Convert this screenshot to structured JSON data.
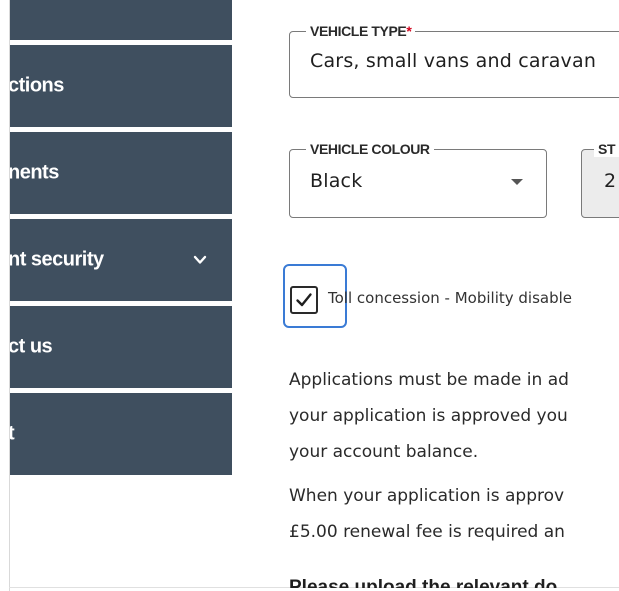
{
  "sidebar": {
    "items": [
      {
        "label": ""
      },
      {
        "label": "ctions"
      },
      {
        "label": "nents"
      },
      {
        "label": "nt security",
        "icon": "chevron-down-icon"
      },
      {
        "label": "ct us"
      },
      {
        "label": "t"
      }
    ]
  },
  "form": {
    "vehicle_type": {
      "label": "VEHICLE TYPE",
      "required_marker": "*",
      "value": "Cars, small vans and caravan"
    },
    "vehicle_colour": {
      "label": "VEHICLE COLOUR",
      "value": "Black"
    },
    "third_field": {
      "label": "ST",
      "value": "2"
    },
    "toll_concession": {
      "checked": true,
      "label": "Toll concession - Mobility disable"
    }
  },
  "content": {
    "paragraph1": [
      "Applications must be made in ad",
      "your application is approved you",
      "your account balance."
    ],
    "paragraph2": [
      "When your application is approv",
      "£5.00 renewal fee is required an"
    ],
    "upload_heading": "Please upload the relevant do"
  },
  "colors": {
    "sidebar_bg": "#3f4f5f",
    "focus_ring": "#3a7bd5",
    "required": "#d0021b"
  }
}
